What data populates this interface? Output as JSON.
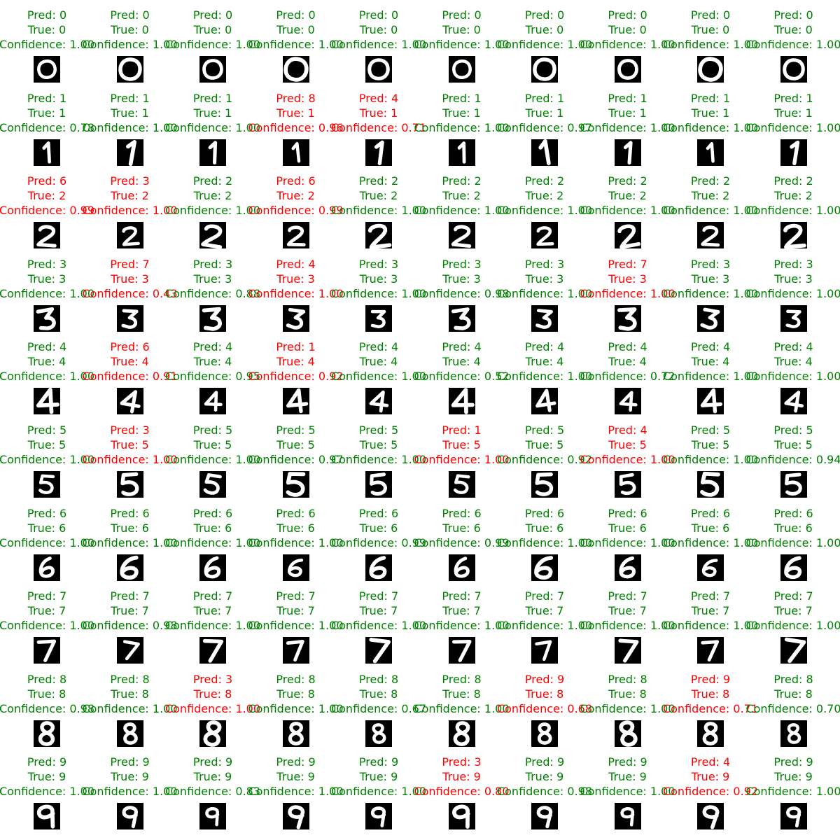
{
  "labels": {
    "pred": "Pred: ",
    "true": "True: ",
    "confidence": "Confidence: "
  },
  "colors": {
    "correct": "#008000",
    "incorrect": "#ff0000",
    "digit_bg": "#000000",
    "digit_fg": "#ffffff"
  },
  "rows": [
    {
      "true": 0,
      "pred": [
        0,
        0,
        0,
        0,
        0,
        0,
        0,
        0,
        0,
        0
      ],
      "confidence": [
        "1.00",
        "1.00",
        "1.00",
        "1.00",
        "1.00",
        "1.00",
        "1.00",
        "1.00",
        "1.00",
        "1.00"
      ]
    },
    {
      "true": 1,
      "pred": [
        1,
        1,
        1,
        8,
        4,
        1,
        1,
        1,
        1,
        1
      ],
      "confidence": [
        "0.78",
        "1.00",
        "1.00",
        "0.96",
        "0.71",
        "1.00",
        "0.97",
        "1.00",
        "1.00",
        "1.00"
      ]
    },
    {
      "true": 2,
      "pred": [
        6,
        3,
        2,
        6,
        2,
        2,
        2,
        2,
        2,
        2
      ],
      "confidence": [
        "0.99",
        "1.00",
        "1.00",
        "0.99",
        "1.00",
        "1.00",
        "1.00",
        "1.00",
        "1.00",
        "1.00"
      ]
    },
    {
      "true": 3,
      "pred": [
        3,
        7,
        3,
        4,
        3,
        3,
        3,
        7,
        3,
        3
      ],
      "confidence": [
        "1.00",
        "0.43",
        "0.88",
        "1.00",
        "1.00",
        "0.98",
        "1.00",
        "1.00",
        "1.00",
        "1.00"
      ]
    },
    {
      "true": 4,
      "pred": [
        4,
        6,
        4,
        1,
        4,
        4,
        4,
        4,
        4,
        4
      ],
      "confidence": [
        "1.00",
        "0.91",
        "0.95",
        "0.92",
        "1.00",
        "0.52",
        "1.00",
        "0.72",
        "1.00",
        "1.00"
      ]
    },
    {
      "true": 5,
      "pred": [
        5,
        3,
        5,
        5,
        5,
        1,
        5,
        4,
        5,
        5
      ],
      "confidence": [
        "1.00",
        "1.00",
        "1.00",
        "0.97",
        "1.00",
        "1.00",
        "0.92",
        "1.00",
        "1.00",
        "0.94"
      ]
    },
    {
      "true": 6,
      "pred": [
        6,
        6,
        6,
        6,
        6,
        6,
        6,
        6,
        6,
        6
      ],
      "confidence": [
        "1.00",
        "1.00",
        "1.00",
        "1.00",
        "0.99",
        "0.99",
        "1.00",
        "1.00",
        "1.00",
        "1.00"
      ]
    },
    {
      "true": 7,
      "pred": [
        7,
        7,
        7,
        7,
        7,
        7,
        7,
        7,
        7,
        7
      ],
      "confidence": [
        "1.00",
        "0.98",
        "1.00",
        "1.00",
        "1.00",
        "1.00",
        "1.00",
        "1.00",
        "1.00",
        "1.00"
      ]
    },
    {
      "true": 8,
      "pred": [
        8,
        8,
        3,
        8,
        8,
        8,
        9,
        8,
        9,
        8
      ],
      "confidence": [
        "0.98",
        "1.00",
        "1.00",
        "1.00",
        "0.67",
        "1.00",
        "0.68",
        "1.00",
        "0.71",
        "0.70"
      ]
    },
    {
      "true": 9,
      "pred": [
        9,
        9,
        9,
        9,
        9,
        3,
        9,
        9,
        4,
        9
      ],
      "confidence": [
        "1.00",
        "1.00",
        "0.83",
        "1.00",
        "1.00",
        "0.80",
        "0.98",
        "1.00",
        "0.92",
        "1.00"
      ]
    }
  ]
}
